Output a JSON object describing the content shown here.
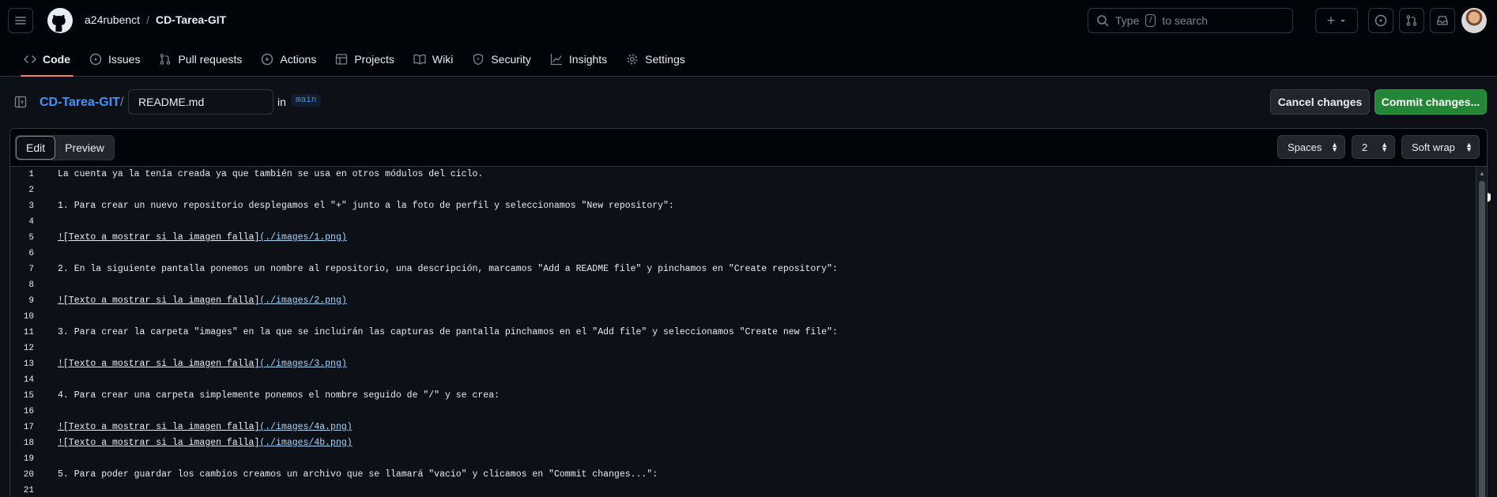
{
  "header": {
    "owner": "a24rubenct",
    "separator": "/",
    "repo": "CD-Tarea-GIT",
    "search_prefix": "Type",
    "search_key": "/",
    "search_suffix": "to search",
    "plus_label": "+"
  },
  "tabs": [
    {
      "label": "Code",
      "icon": "code-icon",
      "active": true
    },
    {
      "label": "Issues",
      "icon": "issue-icon"
    },
    {
      "label": "Pull requests",
      "icon": "pull-request-icon"
    },
    {
      "label": "Actions",
      "icon": "play-icon"
    },
    {
      "label": "Projects",
      "icon": "table-icon"
    },
    {
      "label": "Wiki",
      "icon": "book-icon"
    },
    {
      "label": "Security",
      "icon": "shield-icon"
    },
    {
      "label": "Insights",
      "icon": "graph-icon"
    },
    {
      "label": "Settings",
      "icon": "gear-icon"
    }
  ],
  "filebar": {
    "repo": "CD-Tarea-GIT",
    "separator": "/",
    "filename": "README.md",
    "in_label": "in",
    "branch": "main",
    "cancel_label": "Cancel changes",
    "commit_label": "Commit changes..."
  },
  "editor": {
    "edit_label": "Edit",
    "preview_label": "Preview",
    "indent_mode": "Spaces",
    "indent_size": "2",
    "wrap_mode": "Soft wrap",
    "lines": [
      {
        "n": "1",
        "t": "La cuenta ya la tenía creada ya que también se usa en otros módulos del ciclo."
      },
      {
        "n": "2",
        "t": ""
      },
      {
        "n": "3",
        "t": "1. Para crear un nuevo repositorio desplegamos el \"+\" junto a la foto de perfil y seleccionamos \"New repository\":"
      },
      {
        "n": "4",
        "t": ""
      },
      {
        "n": "5",
        "a": "![Texto a mostrar si la imagen falla]",
        "b": "(./images/1.png)"
      },
      {
        "n": "6",
        "t": ""
      },
      {
        "n": "7",
        "t": "2. En la siguiente pantalla ponemos un nombre al repositorio, una descripción, marcamos \"Add a README file\" y pinchamos en \"Create repository\":"
      },
      {
        "n": "8",
        "t": ""
      },
      {
        "n": "9",
        "a": "![Texto a mostrar si la imagen falla]",
        "b": "(./images/2.png)"
      },
      {
        "n": "10",
        "t": ""
      },
      {
        "n": "11",
        "t": "3. Para crear la carpeta \"images\" en la que se incluirán las capturas de pantalla pinchamos en el \"Add file\" y seleccionamos \"Create new file\":"
      },
      {
        "n": "12",
        "t": ""
      },
      {
        "n": "13",
        "a": "![Texto a mostrar si la imagen falla]",
        "b": "(./images/3.png)"
      },
      {
        "n": "14",
        "t": ""
      },
      {
        "n": "15",
        "t": "4. Para crear una carpeta simplemente ponemos el nombre seguido de \"/\" y se crea:"
      },
      {
        "n": "16",
        "t": ""
      },
      {
        "n": "17",
        "a": "![Texto a mostrar si la imagen falla]",
        "b": "(./images/4a.png)"
      },
      {
        "n": "18",
        "a": "![Texto a mostrar si la imagen falla]",
        "b": "(./images/4b.png)"
      },
      {
        "n": "19",
        "t": ""
      },
      {
        "n": "20",
        "t": "5. Para poder guardar los cambios creamos un archivo que se llamará \"vacio\" y clicamos en \"Commit changes...\":"
      },
      {
        "n": "21",
        "t": ""
      }
    ]
  },
  "colors": {
    "accent_blue": "#4493f8",
    "commit_green": "#238636",
    "tab_underline": "#f78166"
  }
}
